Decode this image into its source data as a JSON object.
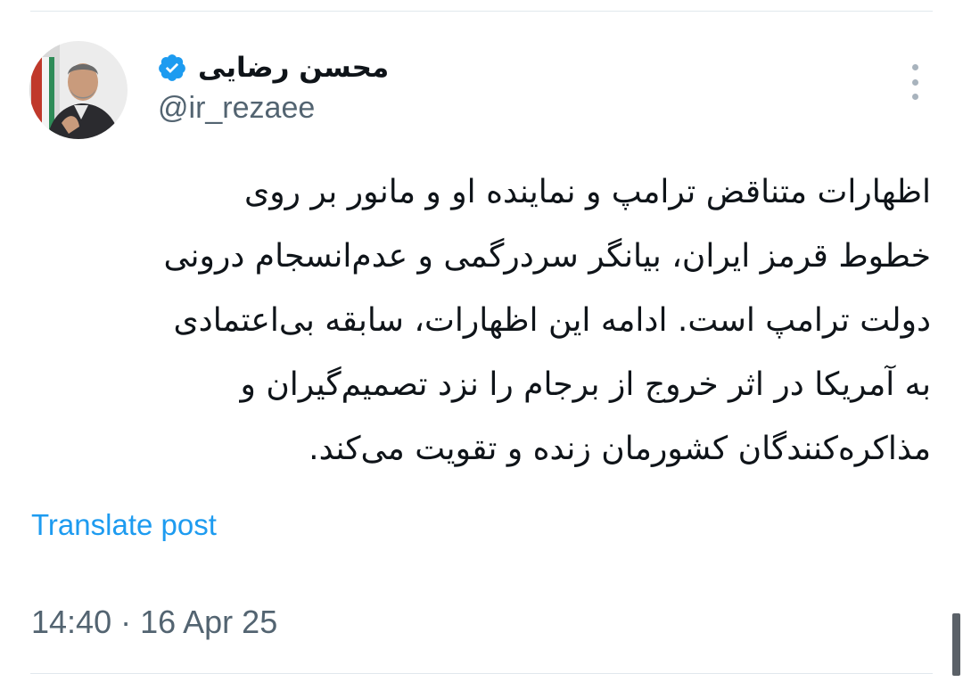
{
  "author": {
    "display_name": "محسن رضایی",
    "handle": "@ir_rezaee",
    "verified_icon": "verified-badge-icon",
    "avatar_icon": "profile-photo"
  },
  "post": {
    "lines": [
      "اظهارات متناقض ترامپ و نماینده او و مانور بر روی",
      "خطوط قرمز ایران، بیانگر سردرگمی و عدم‌انسجام درونی",
      "دولت ترامپ است. ادامه این اظهارات، سابقه بی‌اعتمادی",
      "به آمریکا در اثر خروج از برجام را نزد تصمیم‌گیران و",
      "مذاکره‌کنندگان کشورمان زنده و تقویت می‌کند."
    ],
    "translate_label": "Translate post",
    "time": "14:40",
    "separator": " · ",
    "date": "16 Apr 25"
  },
  "colors": {
    "link": "#1d9bf0",
    "muted": "#536471",
    "verified": "#1d9bf0"
  }
}
